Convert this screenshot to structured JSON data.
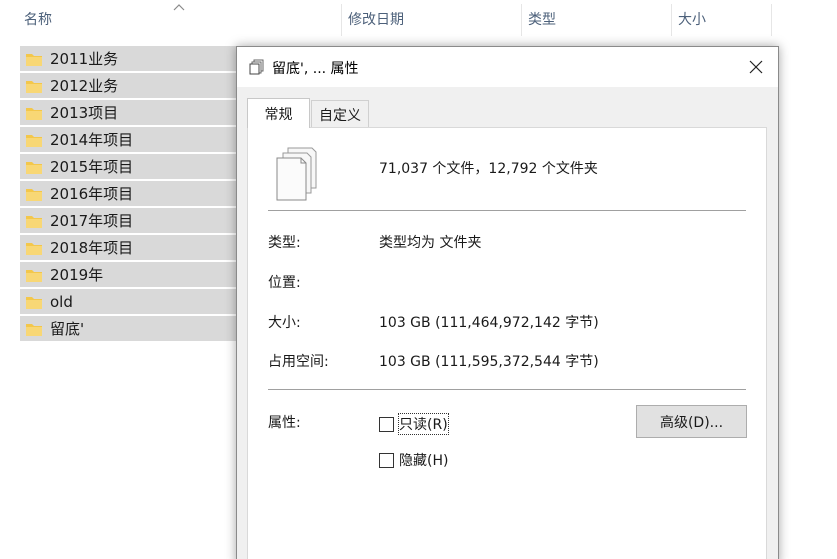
{
  "explorer": {
    "columns": {
      "name": "名称",
      "modified": "修改日期",
      "type": "类型",
      "size": "大小"
    },
    "files": [
      "2011业务",
      "2012业务",
      "2013项目",
      "2014年项目",
      "2015年项目",
      "2016年项目",
      "2017年项目",
      "2018年项目",
      "2019年",
      "old",
      "留底'"
    ]
  },
  "dialog": {
    "title": "留底', ... 属性",
    "tabs": [
      "常规",
      "自定义"
    ],
    "summary": "71,037 个文件，12,792 个文件夹",
    "props": {
      "type_label": "类型:",
      "type_value": "类型均为 文件夹",
      "location_label": "位置:",
      "size_label": "大小:",
      "size_value": "103 GB (111,464,972,142 字节)",
      "disk_label": "占用空间:",
      "disk_value": "103 GB (111,595,372,544 字节)",
      "attrs_label": "属性:"
    },
    "readonly_label": "只读(R)",
    "hidden_label": "隐藏(H)",
    "advanced_label": "高级(D)..."
  },
  "colors": {
    "folder": "#f3c74b",
    "selection": "#d9d9d9",
    "header_text": "#4c607a"
  }
}
